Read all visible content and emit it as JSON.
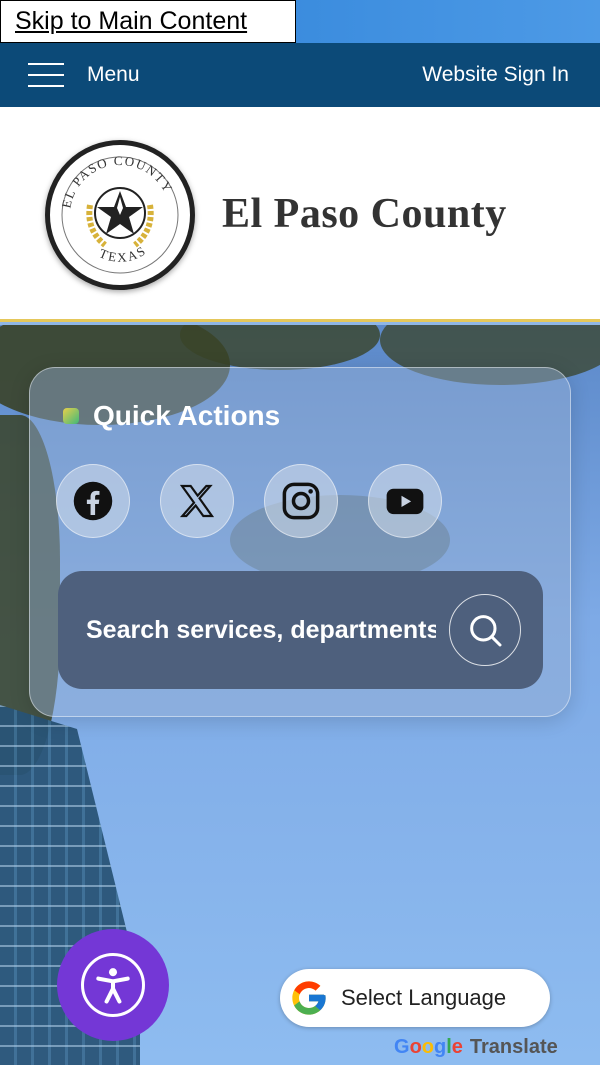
{
  "skip_link": {
    "label": "Skip to Main Content"
  },
  "navbar": {
    "menu_label": "Menu",
    "signin_label": "Website Sign In"
  },
  "header": {
    "county_name": "El Paso County",
    "seal": {
      "top_text": "EL PASO COUNTY",
      "bottom_text": "TEXAS"
    }
  },
  "quick_actions": {
    "title": "Quick Actions",
    "social": [
      {
        "icon": "facebook-icon"
      },
      {
        "icon": "x-icon"
      },
      {
        "icon": "instagram-icon"
      },
      {
        "icon": "youtube-icon"
      }
    ]
  },
  "search": {
    "placeholder": "Search services, departments"
  },
  "translate": {
    "select_label": "Select Language",
    "brand_letters": [
      "G",
      "o",
      "o",
      "g",
      "l",
      "e"
    ],
    "brand_suffix": "Translate"
  },
  "colors": {
    "navbar": "#0c4a78",
    "accent_purple": "#7437d6",
    "gold": "#e5c75a",
    "search_bg": "#4e607d"
  }
}
